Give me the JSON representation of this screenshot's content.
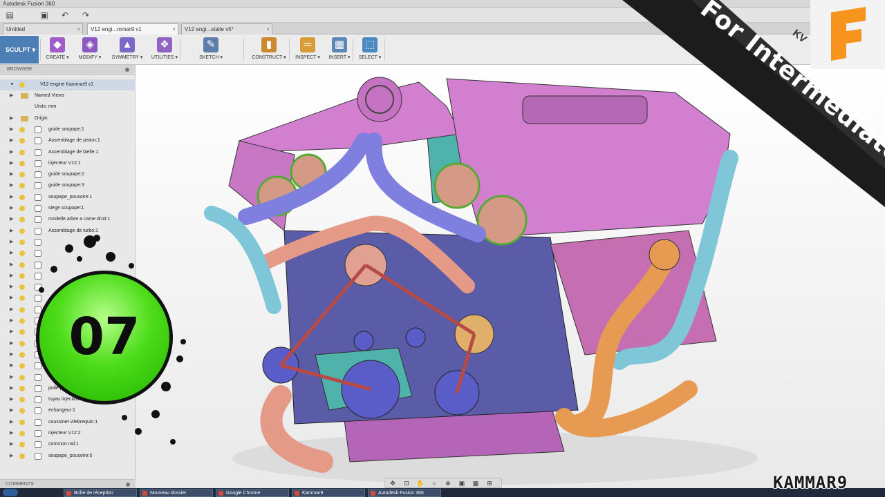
{
  "window": {
    "title": "Autodesk Fusion 360"
  },
  "quick_access": [
    {
      "icon": "file-menu-icon",
      "glyph": "▤"
    },
    {
      "icon": "save-icon",
      "glyph": "▣"
    },
    {
      "icon": "undo-icon",
      "glyph": "↶"
    },
    {
      "icon": "redo-icon",
      "glyph": "↷"
    }
  ],
  "tabs": [
    {
      "label": "Untitled"
    },
    {
      "label": "V12 engi...mmar9 v1"
    },
    {
      "label": "V12 engi...stalle v5*"
    }
  ],
  "workspace": {
    "label": "SCULPT ▾"
  },
  "toolbar": [
    {
      "label": "CREATE ▾",
      "icon": "create-icon",
      "glyph": "◆",
      "color": "#a05cc8"
    },
    {
      "label": "MODIFY ▾",
      "icon": "modify-icon",
      "glyph": "◈",
      "color": "#8c58c2"
    },
    {
      "label": "SYMMETRY ▾",
      "icon": "symmetry-icon",
      "glyph": "▲",
      "color": "#7c68c8"
    },
    {
      "label": "UTILITIES ▾",
      "icon": "utilities-icon",
      "glyph": "❖",
      "color": "#9064c4"
    },
    {
      "label": "SKETCH ▾",
      "icon": "sketch-icon",
      "glyph": "✎",
      "color": "#5d7ea8"
    },
    {
      "label": "CONSTRUCT ▾",
      "icon": "construct-icon",
      "glyph": "▮",
      "color": "#cc8a2e"
    },
    {
      "label": "INSPECT ▾",
      "icon": "inspect-icon",
      "glyph": "═",
      "color": "#d89c3a"
    },
    {
      "label": "INSERT ▾",
      "icon": "insert-icon",
      "glyph": "▦",
      "color": "#5a86b8"
    },
    {
      "label": "SELECT ▾",
      "icon": "select-icon",
      "glyph": "⬚",
      "color": "#4a8ac0"
    }
  ],
  "browser": {
    "title": "BROWSER",
    "root": "V12 engine Kammar9 v1",
    "items": [
      {
        "label": "Named Views",
        "kind": "folder"
      },
      {
        "label": "Units: mm",
        "kind": "unit"
      },
      {
        "label": "Origin",
        "kind": "folder"
      },
      {
        "label": "guide soupape:1",
        "kind": "comp"
      },
      {
        "label": "Assemblage de piston:1",
        "kind": "comp"
      },
      {
        "label": "Assemblage de bielle:1",
        "kind": "comp"
      },
      {
        "label": "injecteur V12:1",
        "kind": "comp"
      },
      {
        "label": "guide soupape:2",
        "kind": "comp"
      },
      {
        "label": "guide soupape:3",
        "kind": "comp"
      },
      {
        "label": "soupape_pousoire:1",
        "kind": "comp"
      },
      {
        "label": "siege soupape:1",
        "kind": "comp"
      },
      {
        "label": "rondelle arbre a came droit:1",
        "kind": "comp"
      },
      {
        "label": "Assemblage de turbo:1",
        "kind": "comp"
      },
      {
        "label": "",
        "kind": "comp"
      },
      {
        "label": "",
        "kind": "comp"
      },
      {
        "label": "",
        "kind": "comp"
      },
      {
        "label": "",
        "kind": "comp"
      },
      {
        "label": "",
        "kind": "comp"
      },
      {
        "label": "",
        "kind": "comp"
      },
      {
        "label": "",
        "kind": "comp"
      },
      {
        "label": "",
        "kind": "comp"
      },
      {
        "label": "",
        "kind": "comp"
      },
      {
        "label": "",
        "kind": "comp"
      },
      {
        "label": "",
        "kind": "comp"
      },
      {
        "label": "",
        "kind": "comp"
      },
      {
        "label": "",
        "kind": "comp"
      },
      {
        "label": "poile poire:1",
        "kind": "comp"
      },
      {
        "label": "tuyau injection02:1",
        "kind": "comp"
      },
      {
        "label": "echangeur:1",
        "kind": "comp"
      },
      {
        "label": "coussinet vilebrequin:1",
        "kind": "comp"
      },
      {
        "label": "injecteur V12:2",
        "kind": "comp"
      },
      {
        "label": "common rail:1",
        "kind": "comp"
      },
      {
        "label": "soupape_pousoire:5",
        "kind": "comp"
      }
    ]
  },
  "comments": {
    "title": "COMMENTS"
  },
  "navbar": [
    {
      "icon": "orbit-icon",
      "glyph": "✥"
    },
    {
      "icon": "look-at-icon",
      "glyph": "⊡"
    },
    {
      "icon": "pan-icon",
      "glyph": "✋"
    },
    {
      "icon": "zoom-icon",
      "glyph": "⌕"
    },
    {
      "icon": "fit-icon",
      "glyph": "⊕"
    },
    {
      "icon": "display-settings-icon",
      "glyph": "▣"
    },
    {
      "icon": "grid-icon",
      "glyph": "▦"
    },
    {
      "icon": "viewports-icon",
      "glyph": "⊞"
    }
  ],
  "taskbar": [
    {
      "label": "Boîte de réception"
    },
    {
      "label": "Nouveau dossier"
    },
    {
      "label": "Google Chrome"
    },
    {
      "label": "Kammar9"
    },
    {
      "label": "Autodesk Fusion 360"
    }
  ],
  "overlay": {
    "level_text": "For Intermediate",
    "badge_number": "07",
    "watermark": "KAMMAR9",
    "corner_mark": "KV",
    "logo_letter": "F"
  },
  "colors": {
    "cover": "#d27fcf",
    "pipe_blue": "#7f7fe0",
    "pipe_cyan": "#7fc6d8",
    "pipe_salmon": "#e49a86",
    "pipe_orange": "#e79a52",
    "block": "#5b5ca8",
    "gear": "#d59a86",
    "teal": "#4fb3ac",
    "badge_green": "#36d21a",
    "brand_orange": "#f7941e"
  }
}
